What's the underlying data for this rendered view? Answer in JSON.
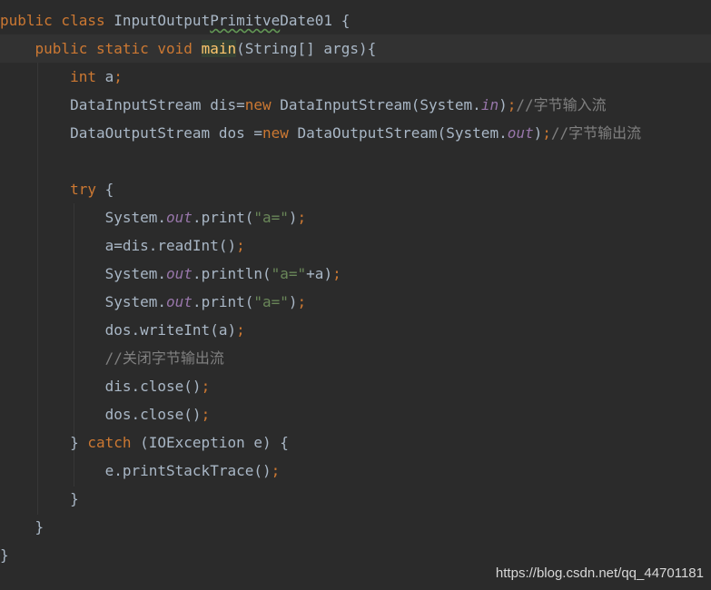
{
  "code": {
    "lines": [
      [
        [
          "kw",
          "public class "
        ],
        [
          "pl",
          "InputOutput"
        ],
        [
          "pl typo",
          "Primitve"
        ],
        [
          "pl",
          "Date01 {"
        ]
      ],
      [
        [
          "kw",
          "    public static void "
        ],
        [
          "fn main-hl",
          "main"
        ],
        [
          "pl",
          "(String[] args){"
        ]
      ],
      [
        [
          "kw",
          "        int "
        ],
        [
          "pl",
          "a"
        ],
        [
          "pn",
          ";"
        ]
      ],
      [
        [
          "pl",
          "        DataInputStream dis="
        ],
        [
          "kw",
          "new "
        ],
        [
          "pl",
          "DataInputStream(System."
        ],
        [
          "st",
          "in"
        ],
        [
          "pl",
          ")"
        ],
        [
          "pn",
          ";"
        ],
        [
          "cm",
          "//字节输入流"
        ]
      ],
      [
        [
          "pl",
          "        DataOutputStream dos ="
        ],
        [
          "kw",
          "new "
        ],
        [
          "pl",
          "DataOutputStream(System."
        ],
        [
          "st",
          "out"
        ],
        [
          "pl",
          ")"
        ],
        [
          "pn",
          ";"
        ],
        [
          "cm",
          "//字节输出流"
        ]
      ],
      [],
      [
        [
          "kw",
          "        try "
        ],
        [
          "pl",
          "{"
        ]
      ],
      [
        [
          "pl",
          "            System."
        ],
        [
          "st",
          "out"
        ],
        [
          "pl",
          ".print("
        ],
        [
          "str",
          "\"a=\""
        ],
        [
          "pl",
          ")"
        ],
        [
          "pn",
          ";"
        ]
      ],
      [
        [
          "pl",
          "            a=dis.readInt()"
        ],
        [
          "pn",
          ";"
        ]
      ],
      [
        [
          "pl",
          "            System."
        ],
        [
          "st",
          "out"
        ],
        [
          "pl",
          ".println("
        ],
        [
          "str",
          "\"a=\""
        ],
        [
          "pl",
          "+a)"
        ],
        [
          "pn",
          ";"
        ]
      ],
      [
        [
          "pl",
          "            System."
        ],
        [
          "st",
          "out"
        ],
        [
          "pl",
          ".print("
        ],
        [
          "str",
          "\"a=\""
        ],
        [
          "pl",
          ")"
        ],
        [
          "pn",
          ";"
        ]
      ],
      [
        [
          "pl",
          "            dos.writeInt(a)"
        ],
        [
          "pn",
          ";"
        ]
      ],
      [
        [
          "cm",
          "            //关闭字节输出流"
        ]
      ],
      [
        [
          "pl",
          "            dis.close()"
        ],
        [
          "pn",
          ";"
        ]
      ],
      [
        [
          "pl",
          "            dos.close()"
        ],
        [
          "pn",
          ";"
        ]
      ],
      [
        [
          "pl",
          "        } "
        ],
        [
          "kw",
          "catch "
        ],
        [
          "pl",
          "(IOException e) {"
        ]
      ],
      [
        [
          "pl",
          "            e.printStackTrace()"
        ],
        [
          "pn",
          ";"
        ]
      ],
      [
        [
          "pl",
          "        }"
        ]
      ],
      [
        [
          "pl",
          "    }"
        ]
      ],
      [
        [
          "pl",
          "}"
        ]
      ]
    ]
  },
  "watermark": "https://blog.csdn.net/qq_44701181"
}
